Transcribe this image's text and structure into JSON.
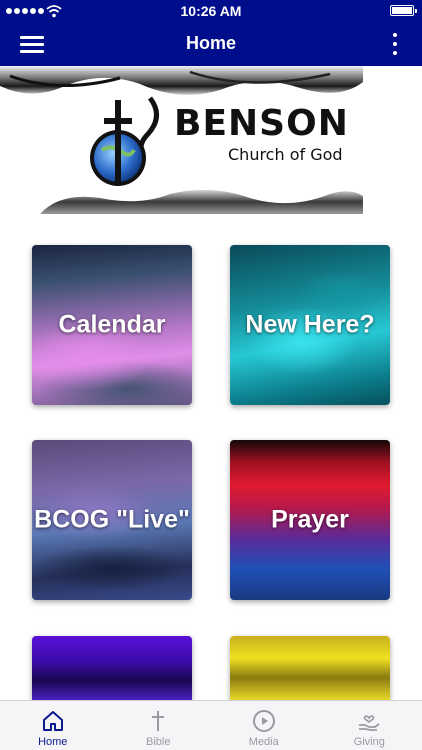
{
  "status_bar": {
    "time": "10:26 AM"
  },
  "nav": {
    "title": "Home"
  },
  "banner": {
    "logo_title": "BENSON",
    "logo_subtitle": "Church of God"
  },
  "tiles": [
    {
      "label": "Calendar"
    },
    {
      "label": "New Here?"
    },
    {
      "label": "BCOG \"Live\""
    },
    {
      "label": "Prayer"
    },
    {
      "label": ""
    },
    {
      "label": ""
    }
  ],
  "tab_bar": {
    "items": [
      {
        "label": "Home",
        "icon": "home-icon",
        "active": true
      },
      {
        "label": "Bible",
        "icon": "cross-icon",
        "active": false
      },
      {
        "label": "Media",
        "icon": "play-circle-icon",
        "active": false
      },
      {
        "label": "Giving",
        "icon": "giving-hand-icon",
        "active": false
      }
    ]
  },
  "colors": {
    "brand": "#000e8c",
    "active_tab": "#0a1a8c",
    "inactive_tab": "#9a9aa0"
  }
}
